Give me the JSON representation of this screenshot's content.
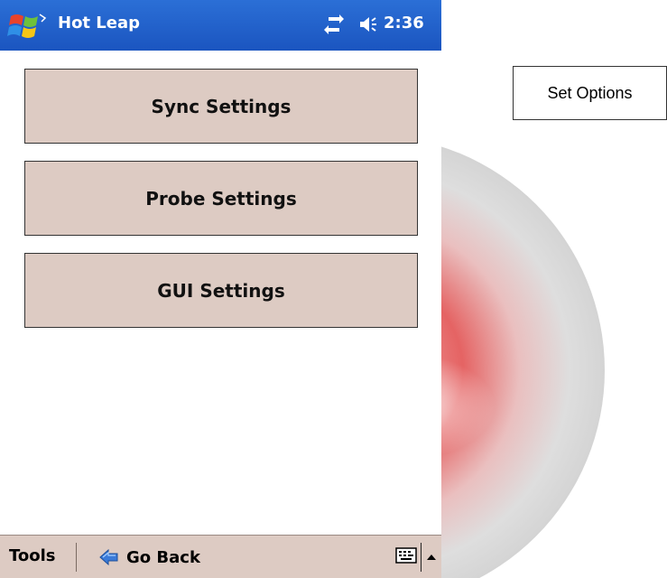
{
  "window": {
    "title": "Hot Leap",
    "clock": "2:36"
  },
  "icons": {
    "start": "windows-flag-icon",
    "connectivity": "sync-arrows-icon",
    "volume": "speaker-icon",
    "back": "back-arrow-icon",
    "keyboard": "keyboard-icon",
    "sip": "up-arrow-icon"
  },
  "buttons": {
    "sync": "Sync Settings",
    "probe": "Probe Settings",
    "gui": "GUI Settings"
  },
  "menubar": {
    "tools": "Tools",
    "go_back": "Go Back"
  },
  "annotation": {
    "label": "Set Options"
  },
  "colors": {
    "titlebar": "#1b55c0",
    "button_face": "#ddcbc3",
    "menubar": "#ddcbc3"
  }
}
